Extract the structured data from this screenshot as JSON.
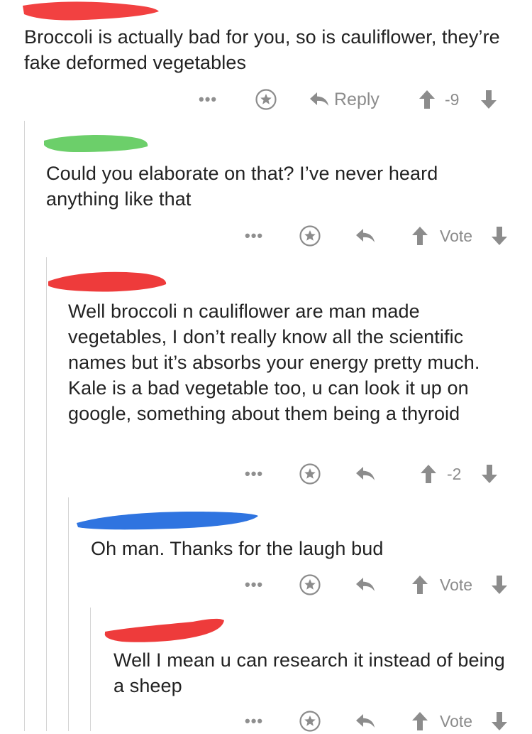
{
  "comments": [
    {
      "text": "Broccoli is actually bad for you, so is cauliflower, they’re fake deformed vegetables",
      "reply_label": "Reply",
      "score": "-9",
      "more": "•••",
      "username_redaction_color": "#f24141"
    },
    {
      "text": "Could you elaborate on that? I’ve never heard anything like that",
      "score": "Vote",
      "more": "•••",
      "username_redaction_color": "#6ccf6a"
    },
    {
      "text": "Well broccoli n cauliflower are man made vegetables, I don’t really know all the scientific names but it’s absorbs your energy pretty much. Kale is a bad vegetable too, u can look it up on google, something about them being a thyroid",
      "score": "-2",
      "more": "•••",
      "username_redaction_color": "#ee3b3b"
    },
    {
      "text": "Oh man. Thanks for the laugh bud",
      "score": "Vote",
      "more": "•••",
      "username_redaction_color": "#2f74e0"
    },
    {
      "text": "Well I mean u can research it instead of being a sheep",
      "score": "Vote",
      "more": "•••",
      "username_redaction_color": "#ee3b3b"
    }
  ],
  "colors": {
    "icon_gray": "#8c8c8c",
    "thread_line": "#d4d4d4",
    "text": "#222222"
  },
  "icons": [
    "more-icon",
    "star-icon",
    "reply-icon",
    "upvote-icon",
    "downvote-icon"
  ]
}
